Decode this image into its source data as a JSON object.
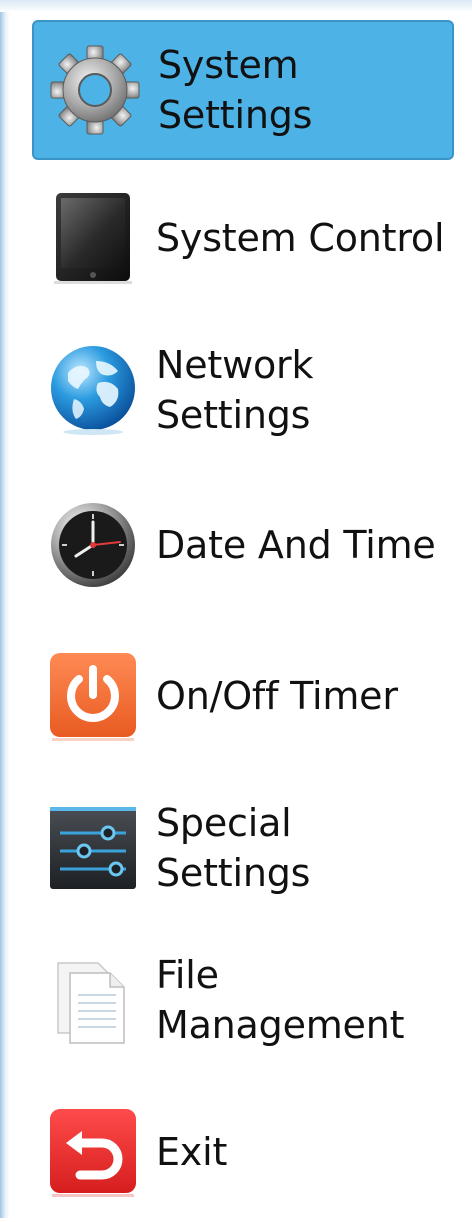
{
  "menu": {
    "items": [
      {
        "label": "System\nSettings",
        "icon": "gear-icon",
        "selected": true
      },
      {
        "label": "System Control",
        "icon": "tablet-icon",
        "selected": false
      },
      {
        "label": "Network\nSettings",
        "icon": "globe-icon",
        "selected": false
      },
      {
        "label": "Date And Time",
        "icon": "clock-icon",
        "selected": false
      },
      {
        "label": "On/Off Timer",
        "icon": "power-icon",
        "selected": false
      },
      {
        "label": "Special\nSettings",
        "icon": "sliders-icon",
        "selected": false
      },
      {
        "label": "File\nManagement",
        "icon": "document-icon",
        "selected": false
      },
      {
        "label": "Exit",
        "icon": "exit-icon",
        "selected": false
      }
    ]
  },
  "colors": {
    "selected_bg": "#4db3e7",
    "selected_border": "#3a95c6",
    "text": "#111111"
  }
}
